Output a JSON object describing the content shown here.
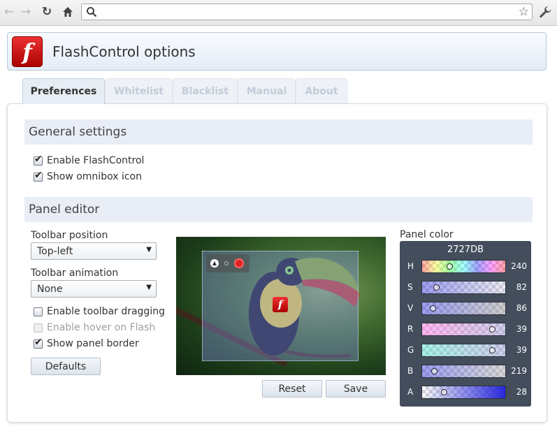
{
  "browser": {
    "omnibox_value": "",
    "icons": [
      "back-arrow-icon",
      "forward-arrow-icon",
      "reload-icon",
      "home-icon",
      "search-icon",
      "star-icon",
      "wrench-icon"
    ]
  },
  "header": {
    "title": "FlashControl options",
    "logo_letter": "f"
  },
  "tabs": [
    {
      "label": "Preferences",
      "active": true
    },
    {
      "label": "Whitelist"
    },
    {
      "label": "Blacklist"
    },
    {
      "label": "Manual"
    },
    {
      "label": "About"
    }
  ],
  "general": {
    "heading": "General settings",
    "enable_flashcontrol": {
      "label": "Enable FlashControl",
      "checked": true
    },
    "show_omnibox_icon": {
      "label": "Show omnibox icon",
      "checked": true
    }
  },
  "panel_editor": {
    "heading": "Panel editor",
    "toolbar_position_label": "Toolbar position",
    "toolbar_position_value": "Top-left",
    "toolbar_animation_label": "Toolbar animation",
    "toolbar_animation_value": "None",
    "enable_toolbar_dragging": {
      "label": "Enable toolbar dragging",
      "checked": false
    },
    "enable_hover_on_flash": {
      "label": "Enable hover on Flash",
      "checked": false,
      "disabled": true
    },
    "show_panel_border": {
      "label": "Show panel border",
      "checked": true
    },
    "defaults_label": "Defaults",
    "reset_label": "Reset",
    "save_label": "Save",
    "panel_color_label": "Panel color",
    "panel_color_hex": "2727DB",
    "channels": [
      {
        "label": "H",
        "value": "240",
        "fraction": 0.33
      },
      {
        "label": "S",
        "value": "82",
        "fraction": 0.17
      },
      {
        "label": "V",
        "value": "86",
        "fraction": 0.13
      },
      {
        "label": "R",
        "value": "39",
        "fraction": 0.84
      },
      {
        "label": "G",
        "value": "39",
        "fraction": 0.84
      },
      {
        "label": "B",
        "value": "219",
        "fraction": 0.14
      },
      {
        "label": "A",
        "value": "28",
        "fraction": 0.26
      }
    ]
  },
  "colors": {
    "accent": "#2727DB",
    "flash_red": "#cc1f1f"
  }
}
